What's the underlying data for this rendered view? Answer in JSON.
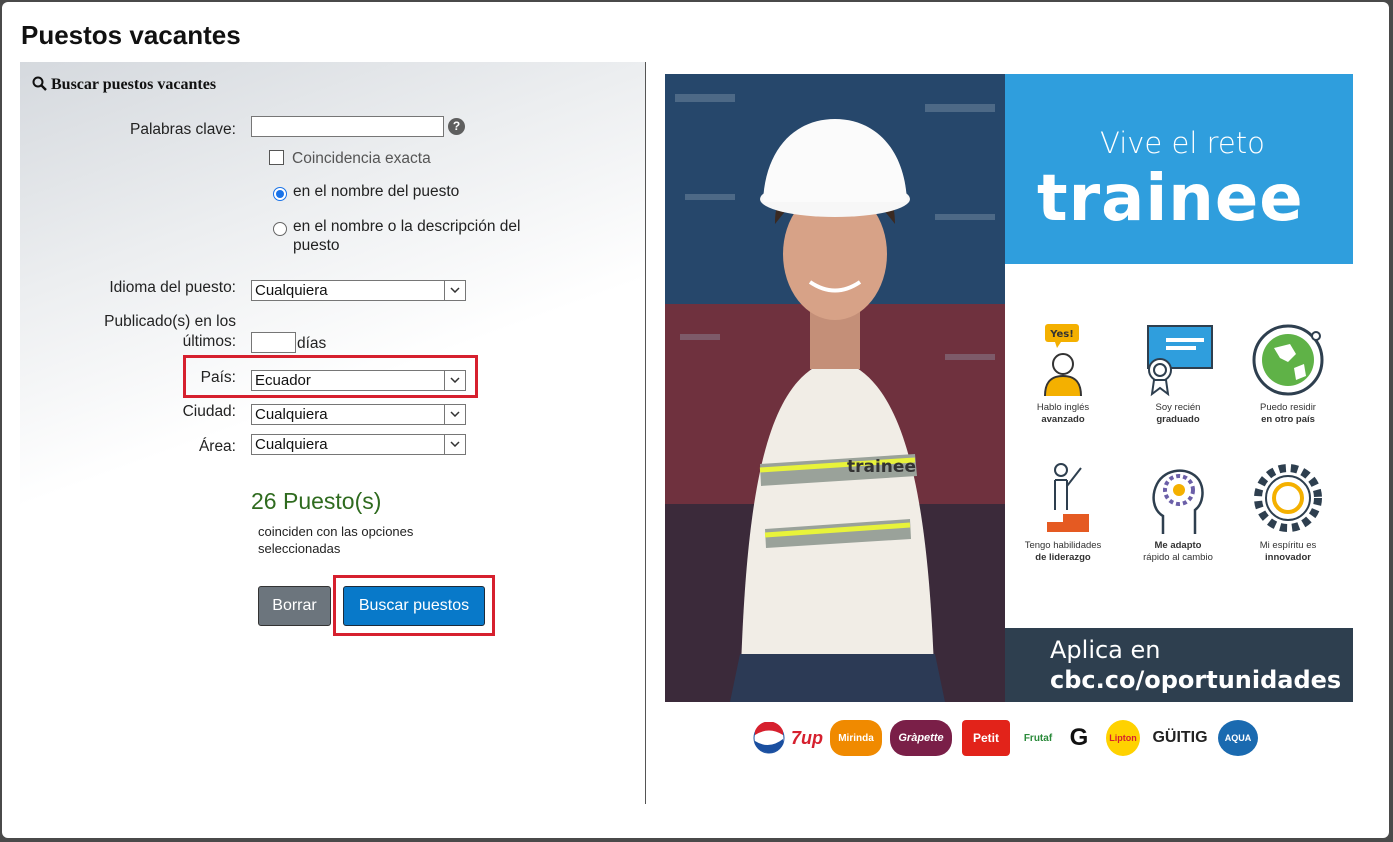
{
  "page": {
    "title": "Puestos vacantes"
  },
  "search": {
    "header": "Buscar puestos vacantes",
    "keywords_label": "Palabras clave:",
    "keywords_value": "",
    "help_icon": "?",
    "exact_match_label": "Coincidencia exacta",
    "exact_match_checked": false,
    "radio_name_label": "en el nombre del puesto",
    "radio_desc_label_line1": "en el nombre o la descripción del",
    "radio_desc_label_line2": "puesto",
    "radio_selected": "name",
    "language_label": "Idioma del puesto:",
    "language_value": "Cualquiera",
    "published_label_line1": "Publicado(s) en los",
    "published_label_line2": "últimos:",
    "published_days_value": "",
    "days_label": "días",
    "country_label": "País:",
    "country_value": "Ecuador",
    "city_label": "Ciudad:",
    "city_value": "Cualquiera",
    "area_label": "Área:",
    "area_value": "Cualquiera",
    "result_count": "26 Puesto(s)",
    "result_text": "coinciden con las opciones seleccionadas",
    "clear_button": "Borrar",
    "search_button": "Buscar puestos"
  },
  "banner": {
    "headline_small": "Vive el reto",
    "headline_big": "trainee",
    "shirt_text": "trainee",
    "features": [
      {
        "icon": "english-speaker-icon",
        "badge": "Yes!",
        "line1": "Hablo inglés",
        "line2": "avanzado"
      },
      {
        "icon": "diploma-icon",
        "line1": "Soy recién",
        "line2": "graduado"
      },
      {
        "icon": "globe-icon",
        "line1": "Puedo residir",
        "line2": "en otro país"
      },
      {
        "icon": "leadership-icon",
        "line1": "Tengo habilidades",
        "line2": "de liderazgo"
      },
      {
        "icon": "adaptable-mind-icon",
        "line1": "Me adapto",
        "line2": "rápido al cambio"
      },
      {
        "icon": "innovation-gear-icon",
        "line1": "Mi espíritu es",
        "line2": "innovador"
      }
    ],
    "cta_line1": "Aplica en",
    "cta_line2": "cbc.co/oportunidades"
  },
  "brands": [
    "Pepsi",
    "7up",
    "Mirinda",
    "Gràpette",
    "Petit",
    "Frutaf",
    "G",
    "Lipton",
    "GÜITIG",
    "AQUA"
  ],
  "colors": {
    "accent_blue": "#0879c9",
    "highlight_red": "#d6202e",
    "count_green": "#2f6b1f",
    "banner_blue": "#2f9edd",
    "banner_dark": "#2e3f4f"
  }
}
